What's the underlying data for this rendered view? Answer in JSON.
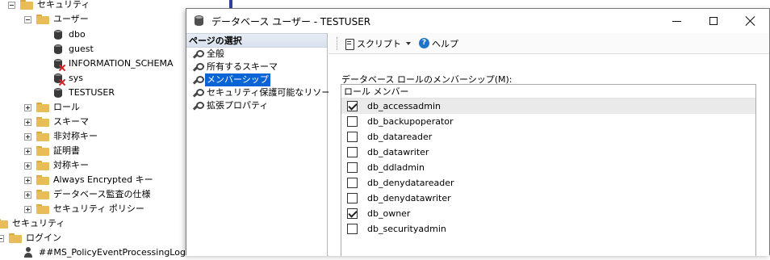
{
  "tree": {
    "items": [
      {
        "label": "セキュリティ",
        "icon": "folder-icon",
        "expander": "minus"
      },
      {
        "label": "ユーザー",
        "icon": "folder-icon",
        "expander": "minus"
      },
      {
        "label": "dbo",
        "icon": "db-user-icon"
      },
      {
        "label": "guest",
        "icon": "db-user-icon"
      },
      {
        "label": "INFORMATION_SCHEMA",
        "icon": "db-user-disabled-icon"
      },
      {
        "label": "sys",
        "icon": "db-user-disabled-icon"
      },
      {
        "label": "TESTUSER",
        "icon": "db-user-icon"
      },
      {
        "label": "ロール",
        "icon": "folder-icon",
        "expander": "plus"
      },
      {
        "label": "スキーマ",
        "icon": "folder-icon",
        "expander": "plus"
      },
      {
        "label": "非対称キー",
        "icon": "folder-icon",
        "expander": "plus"
      },
      {
        "label": "証明書",
        "icon": "folder-icon",
        "expander": "plus"
      },
      {
        "label": "対称キー",
        "icon": "folder-icon",
        "expander": "plus"
      },
      {
        "label": "Always Encrypted キー",
        "icon": "folder-icon",
        "expander": "plus"
      },
      {
        "label": "データベース監査の仕様",
        "icon": "folder-icon",
        "expander": "plus"
      },
      {
        "label": "セキュリティ ポリシー",
        "icon": "folder-icon",
        "expander": "plus"
      },
      {
        "label": "セキュリティ",
        "icon": "folder-icon"
      },
      {
        "label": "ログイン",
        "icon": "folder-icon",
        "expander": "minus"
      },
      {
        "label": "##MS_PolicyEventProcessingLogin##",
        "icon": "login-icon"
      }
    ]
  },
  "dialog": {
    "title": "データベース ユーザー - TESTUSER",
    "window_buttons": {
      "minimize": "minimize-icon",
      "maximize": "maximize-icon",
      "close": "close-icon"
    },
    "pages": {
      "header": "ページの選択",
      "items": [
        {
          "label": "全般",
          "selected": false
        },
        {
          "label": "所有するスキーマ",
          "selected": false
        },
        {
          "label": "メンバーシップ",
          "selected": true
        },
        {
          "label": "セキュリティ保護可能なリソース",
          "selected": false
        },
        {
          "label": "拡張プロパティ",
          "selected": false
        }
      ]
    },
    "toolbar": {
      "script_label": "スクリプト",
      "help_label": "ヘルプ"
    },
    "membership": {
      "label": "データベース ロールのメンバーシップ(M):",
      "column_header": "ロール メンバー",
      "roles": [
        {
          "name": "db_accessadmin",
          "checked": true,
          "selected": true
        },
        {
          "name": "db_backupoperator",
          "checked": false,
          "selected": false
        },
        {
          "name": "db_datareader",
          "checked": false,
          "selected": false
        },
        {
          "name": "db_datawriter",
          "checked": false,
          "selected": false
        },
        {
          "name": "db_ddladmin",
          "checked": false,
          "selected": false
        },
        {
          "name": "db_denydatareader",
          "checked": false,
          "selected": false
        },
        {
          "name": "db_denydatawriter",
          "checked": false,
          "selected": false
        },
        {
          "name": "db_owner",
          "checked": true,
          "selected": false
        },
        {
          "name": "db_securityadmin",
          "checked": false,
          "selected": false
        }
      ]
    }
  },
  "colors": {
    "selection_blue": "#0a64d6",
    "folder_yellow": "#e8bd57",
    "disabled_red": "#d32020"
  }
}
